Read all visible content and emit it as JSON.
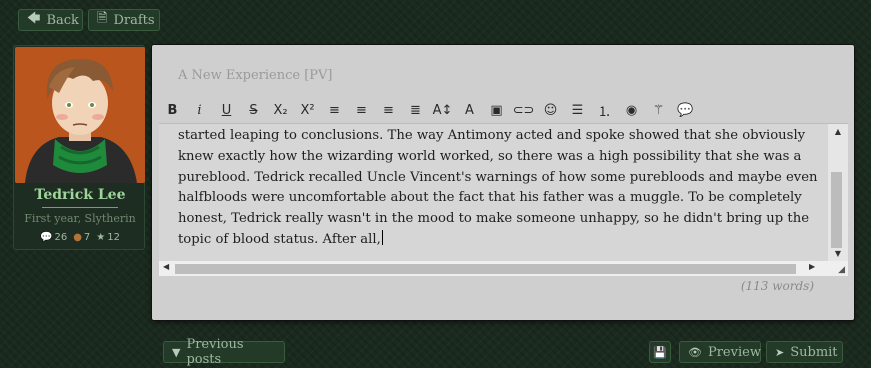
{
  "nav": {
    "back_label": "Back",
    "drafts_label": "Drafts"
  },
  "character": {
    "name": "Tedrick Lee",
    "subtitle": "First year, Slytherin",
    "stats": {
      "posts": "26",
      "coins": "7",
      "stars": "12"
    }
  },
  "editor": {
    "title": "A New Experience [PV]",
    "body": "started leaping to conclusions. The way Antimony acted and spoke showed that she obviously knew exactly how the wizarding world worked, so there was a high possibility that she was a pureblood. Tedrick recalled Uncle Vincent's warnings of how some purebloods and maybe even halfbloods were uncomfortable about the fact that his father was a muggle. To be completely honest, Tedrick really wasn't in the mood to make someone unhappy, so he didn't bring up the topic of blood status. After all,",
    "word_count": "(113 words)",
    "toolbar": [
      {
        "name": "bold-button",
        "glyph": "B"
      },
      {
        "name": "italic-button",
        "glyph": "i"
      },
      {
        "name": "underline-button",
        "glyph": "U"
      },
      {
        "name": "strikethrough-button",
        "glyph": "S"
      },
      {
        "name": "subscript-button",
        "glyph": "X₂"
      },
      {
        "name": "superscript-button",
        "glyph": "X²"
      },
      {
        "name": "align-left-button",
        "glyph": "≡"
      },
      {
        "name": "align-center-button",
        "glyph": "≡"
      },
      {
        "name": "align-right-button",
        "glyph": "≡"
      },
      {
        "name": "justify-button",
        "glyph": "≣"
      },
      {
        "name": "font-size-button",
        "glyph": "A↕"
      },
      {
        "name": "text-color-button",
        "glyph": "A"
      },
      {
        "name": "image-button",
        "glyph": "▣"
      },
      {
        "name": "link-button",
        "glyph": "⊂⊃"
      },
      {
        "name": "emoji-button",
        "glyph": "☺"
      },
      {
        "name": "bullet-list-button",
        "glyph": "☰"
      },
      {
        "name": "numbered-list-button",
        "glyph": "⒈"
      },
      {
        "name": "hide-button",
        "glyph": "◉"
      },
      {
        "name": "magic-wand-button",
        "glyph": "⚚"
      },
      {
        "name": "quote-button",
        "glyph": "💬"
      }
    ]
  },
  "footer": {
    "previous_label": "Previous posts",
    "preview_label": "Preview",
    "submit_label": "Submit"
  },
  "colors": {
    "background": "#1a2a1e",
    "button_bg": "#243a28",
    "name_green": "#9fd49b",
    "avatar_bg": "#b9551d"
  }
}
